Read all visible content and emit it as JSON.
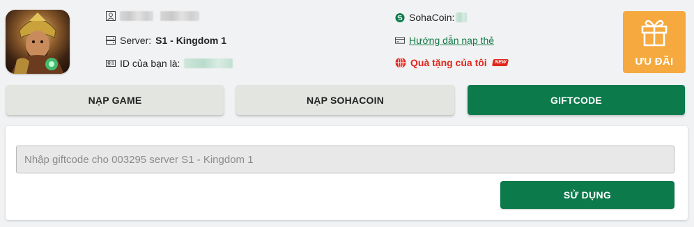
{
  "header": {
    "server_label": "Server:",
    "server_value": "S1 - Kingdom 1",
    "id_label": "ID của bạn là:",
    "sohacoin_label": "SohaCoin:",
    "guide_link": "Hướng dẫn nạp thẻ",
    "my_gifts_link": "Quà tặng của tôi",
    "new_badge": "NEW",
    "promo_label": "ƯU ĐÃI"
  },
  "tabs": [
    {
      "label": "NẠP GAME",
      "active": false
    },
    {
      "label": "NẠP SOHACOIN",
      "active": false
    },
    {
      "label": "GIFTCODE",
      "active": true
    }
  ],
  "giftcode": {
    "placeholder": "Nhập giftcode cho 003295 server S1 - Kingdom 1",
    "value": "",
    "submit_label": "SỬ DỤNG"
  },
  "colors": {
    "primary_green": "#0c7a4b",
    "promo_orange": "#f5a93f",
    "gift_red": "#e1251b",
    "tab_inactive": "#e2e5e0",
    "page_bg": "#f1f2f3"
  },
  "icons": {
    "username": "user-icon",
    "server": "server-icon",
    "id": "id-card-icon",
    "sohacoin": "sohacoin-icon",
    "guide": "card-icon",
    "gifts": "globe-gift-icon",
    "promo": "gift-icon"
  }
}
